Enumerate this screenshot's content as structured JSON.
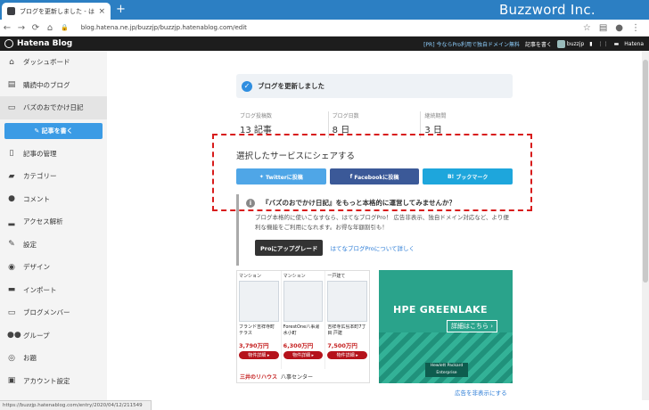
{
  "browser": {
    "tab_title": "ブログを更新しました - はてなブログ",
    "tab_close": "×",
    "new_tab": "+",
    "brand": "Buzzword Inc.",
    "url": "blog.hatena.ne.jp/buzzjp/buzzjp.hatenablog.com/edit",
    "status_url": "https://buzzjp.hatenablog.com/entry/2020/04/12/211549"
  },
  "header": {
    "logo": "Hatena Blog",
    "promo": "[PR] 今ならPro利用で独自ドメイン無料",
    "write": "記事を書く",
    "user": "buzzjp",
    "hatena": "Hatena"
  },
  "sidebar": {
    "items": [
      {
        "label": "ダッシュボード",
        "icon": "home-icon"
      },
      {
        "label": "購読中のブログ",
        "icon": "reader-icon"
      },
      {
        "label": "バズのおでかけ日記",
        "icon": "blog-icon"
      }
    ],
    "write_button": "記事を書く",
    "items2": [
      {
        "label": "記事の管理",
        "icon": "document-icon"
      },
      {
        "label": "カテゴリー",
        "icon": "folder-icon"
      },
      {
        "label": "コメント",
        "icon": "comment-icon"
      },
      {
        "label": "アクセス解析",
        "icon": "chart-icon"
      },
      {
        "label": "設定",
        "icon": "wrench-icon"
      },
      {
        "label": "デザイン",
        "icon": "palette-icon"
      },
      {
        "label": "インポート",
        "icon": "import-icon"
      },
      {
        "label": "ブログメンバー",
        "icon": "members-icon"
      },
      {
        "label": "グループ",
        "icon": "group-icon"
      },
      {
        "label": "お題",
        "icon": "theme-icon"
      },
      {
        "label": "アカウント設定",
        "icon": "account-icon"
      }
    ]
  },
  "main": {
    "notice": "ブログを更新しました",
    "stats": [
      {
        "label": "ブログ投稿数",
        "value": "13 記事"
      },
      {
        "label": "ブログ日数",
        "value": "8 日"
      },
      {
        "label": "継続期間",
        "value": "3 日"
      }
    ],
    "share_title": "選択したサービスにシェアする",
    "share_buttons": {
      "twitter": "Twitterに投稿",
      "facebook": "Facebookに投稿",
      "hatebu": "ブックマーク"
    },
    "pro": {
      "heading": "『バズのおでかけ日記』をもっと本格的に運営してみませんか？",
      "text": "ブログ本格的に使いこなすなら、はてなブログPro！ 広告非表示、独自ドメイン対応など、より便利な機能をご利用になれます。お得な年額割引も！",
      "button": "Proにアップグレード",
      "link": "はてなブログProについて詳しく"
    },
    "ad1": {
      "columns": [
        {
          "tag": "マンション",
          "name": "ブランド吉祥寺町テラス",
          "price": "3,790万円",
          "detail": "物件詳細 ▸"
        },
        {
          "tag": "マンション",
          "name": "ForestOne八事湯水小町",
          "price": "6,300万円",
          "detail": "物件詳細 ▸"
        },
        {
          "tag": "一戸建て",
          "name": "吉祥寺広島本町7丁目 戸建",
          "price": "7,500万円",
          "detail": "物件詳細 ▸"
        }
      ],
      "logo": "三井のリハウス",
      "store": "八事センター"
    },
    "ad2": {
      "title": "HPE GREENLAKE",
      "button": "詳細はこちら ›",
      "logo": "Hewlett Packard Enterprise"
    },
    "hide_ads": "広告を非表示にする"
  }
}
